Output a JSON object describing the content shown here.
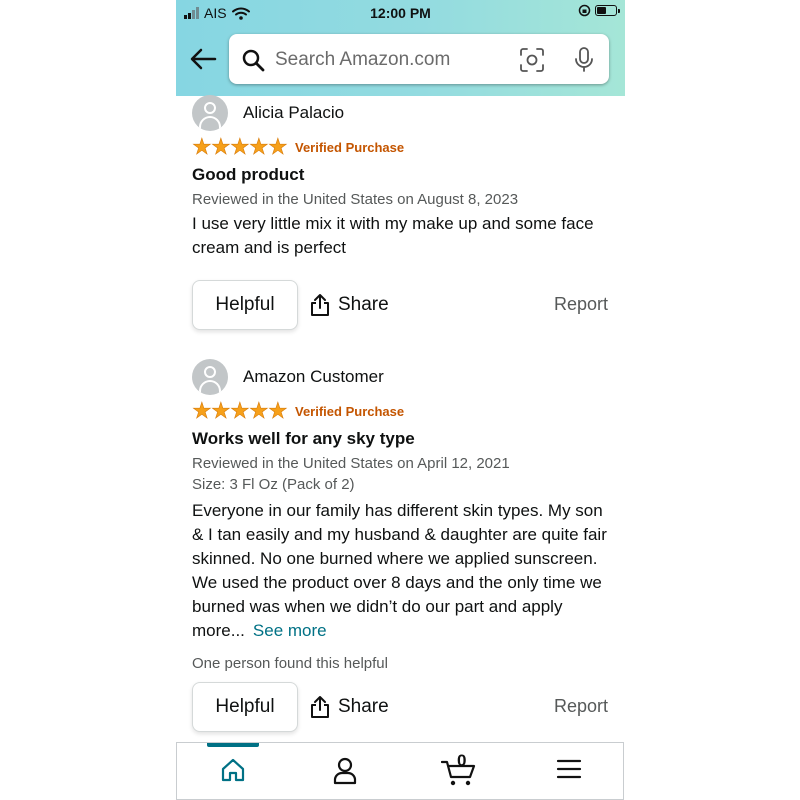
{
  "status_bar": {
    "carrier": "AIS",
    "time": "12:00 PM"
  },
  "search": {
    "placeholder": "Search Amazon.com"
  },
  "reviews": [
    {
      "reviewer": "Alicia Palacio",
      "stars": 5,
      "badge": "Verified Purchase",
      "title": "Good product",
      "meta": "Reviewed in the United States on August 8, 2023",
      "body": "I use very little mix it with my make up and some face cream and is perfect",
      "helpful_label": "Helpful",
      "share_label": "Share",
      "report_label": "Report"
    },
    {
      "reviewer": "Amazon Customer",
      "stars": 5,
      "badge": "Verified Purchase",
      "title": "Works well for any sky type",
      "meta": "Reviewed in the United States on April 12, 2021",
      "size": "Size: 3 Fl Oz (Pack of 2)",
      "body": "Everyone in our family has different skin types. My son & I tan easily and my husband & daughter are quite fair skinned. No one burned where we applied sunscreen. We used the product over 8 days and the only time we burned was when we didn’t do our part and apply more...",
      "see_more": "See more",
      "found_helpful": "One person found this helpful",
      "helpful_label": "Helpful",
      "share_label": "Share",
      "report_label": "Report"
    }
  ],
  "bottom_nav": {
    "cart_count": "0",
    "active": "home"
  },
  "colors": {
    "accent": "#007185",
    "star": "#f6a01a",
    "verified": "#c45500",
    "header_gradient_start": "#86d6e2",
    "header_gradient_end": "#a5e6d7"
  },
  "icons": [
    "back-arrow-icon",
    "search-icon",
    "camera-scan-icon",
    "microphone-icon",
    "share-icon",
    "home-icon",
    "account-icon",
    "cart-icon",
    "menu-icon"
  ]
}
